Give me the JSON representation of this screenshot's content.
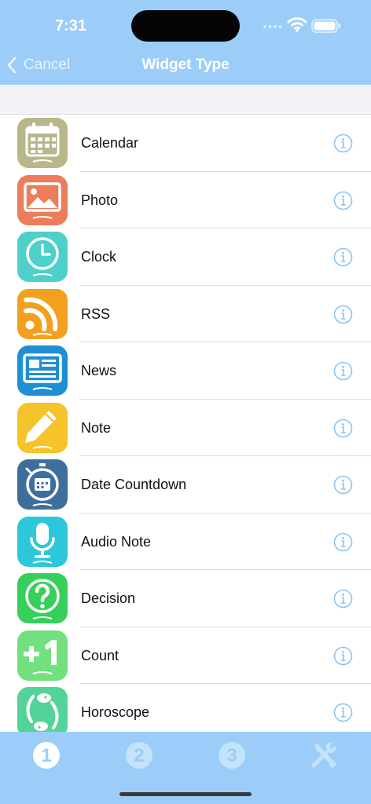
{
  "status_bar": {
    "time": "7:31",
    "icons": [
      "cellular-dots-icon",
      "wifi-icon",
      "battery-icon"
    ]
  },
  "nav": {
    "back_label": "Cancel",
    "back_icon": "chevron-left-icon",
    "title": "Widget Type"
  },
  "widgets": [
    {
      "label": "Calendar",
      "icon": "calendar-icon",
      "color": "#b9b78a"
    },
    {
      "label": "Photo",
      "icon": "photo-icon",
      "color": "#ec7d5b"
    },
    {
      "label": "Clock",
      "icon": "clock-icon",
      "color": "#4fcfc9"
    },
    {
      "label": "RSS",
      "icon": "rss-icon",
      "color": "#f2a01e"
    },
    {
      "label": "News",
      "icon": "news-icon",
      "color": "#1f8fd3"
    },
    {
      "label": "Note",
      "icon": "pencil-icon",
      "color": "#f5c32a"
    },
    {
      "label": "Date Countdown",
      "icon": "stopwatch-calendar-icon",
      "color": "#3e6f9c"
    },
    {
      "label": "Audio Note",
      "icon": "microphone-icon",
      "color": "#2cc7d9"
    },
    {
      "label": "Decision",
      "icon": "question-mark-icon",
      "color": "#36cf5a"
    },
    {
      "label": "Count",
      "icon": "plus-one-icon",
      "color": "#72e07d"
    },
    {
      "label": "Horoscope",
      "icon": "pisces-icon",
      "color": "#52d39a"
    }
  ],
  "info_icon": "info-circle-icon",
  "tabbar": {
    "tabs": [
      {
        "icon": "step-1-icon",
        "glyph": "1",
        "active": true
      },
      {
        "icon": "step-2-icon",
        "glyph": "2",
        "active": false
      },
      {
        "icon": "step-3-icon",
        "glyph": "3",
        "active": false
      },
      {
        "icon": "tools-icon",
        "active": false
      }
    ],
    "active_color": "#ffffff",
    "inactive_color": "#c4e2fb"
  },
  "colors": {
    "accent": "#9bcdf8",
    "info_icon": "#8cc3f2",
    "text": "#111111",
    "section_bg": "#f2f2f7"
  }
}
